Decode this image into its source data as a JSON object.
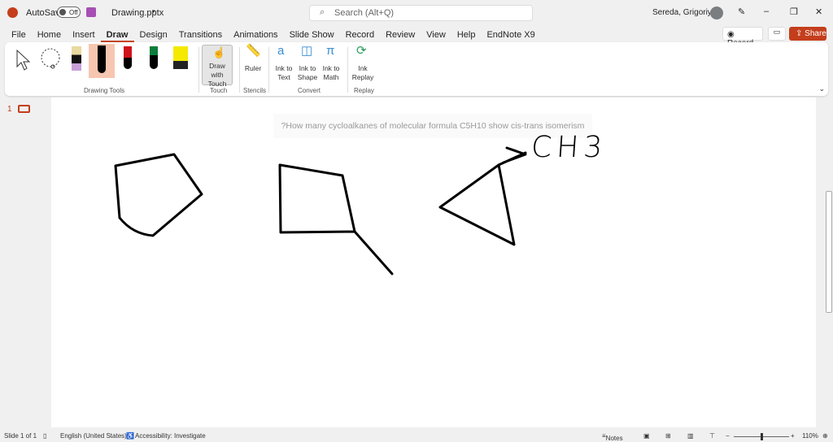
{
  "titlebar": {
    "autosave": "AutoSave",
    "toggle": "Off",
    "filename": "Drawing.pptx",
    "search_placeholder": "Search (Alt+Q)",
    "user": "Sereda, Grigoriy A"
  },
  "tabs": [
    "File",
    "Home",
    "Insert",
    "Draw",
    "Design",
    "Transitions",
    "Animations",
    "Slide Show",
    "Record",
    "Review",
    "View",
    "Help",
    "EndNote X9"
  ],
  "actions": {
    "record": "Record",
    "share": "Share"
  },
  "ribbon": {
    "groups": {
      "drawing_tools": "Drawing Tools",
      "touch": "Touch",
      "stencils": "Stencils",
      "convert": "Convert",
      "replay": "Replay"
    },
    "draw_with_touch": "Draw with Touch",
    "ruler": "Ruler",
    "ink_to_text": "Ink to Text",
    "ink_to_shape": "Ink to Shape",
    "ink_to_math": "Ink to Math",
    "ink_replay": "Ink Replay",
    "pen_colors": [
      "#e8d9a0",
      "#000000",
      "#d0131d",
      "#0a7d3a",
      "#f5e900"
    ]
  },
  "thumbnail": {
    "number": "1"
  },
  "slide": {
    "question": "?How many cycloalkanes of molecular formula C5H10 show cis-trans isomerism",
    "ink_label": "CH3"
  },
  "status": {
    "slide": "Slide 1 of 1",
    "language": "English (United States)",
    "accessibility": "Accessibility: Investigate",
    "notes": "Notes",
    "zoom": "110%"
  }
}
